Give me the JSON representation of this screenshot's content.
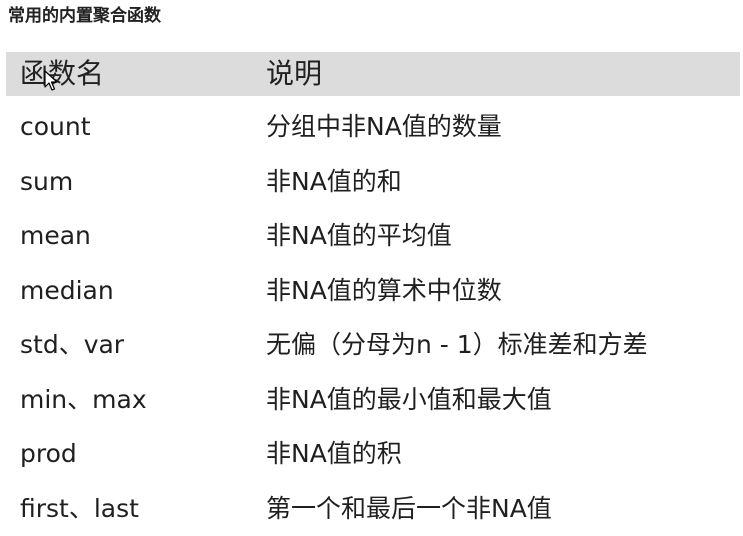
{
  "heading": "常用的内置聚合函数",
  "table": {
    "headers": [
      "函数名",
      "说明"
    ],
    "rows": [
      [
        "count",
        "分组中非NA值的数量"
      ],
      [
        "sum",
        "非NA值的和"
      ],
      [
        "mean",
        "非NA值的平均值"
      ],
      [
        "median",
        "非NA值的算术中位数"
      ],
      [
        "std、var",
        "无偏（分母为n - 1）标准差和方差"
      ],
      [
        "min、max",
        "非NA值的最小值和最大值"
      ],
      [
        "prod",
        "非NA值的积"
      ],
      [
        "first、last",
        "第一个和最后一个非NA值"
      ]
    ]
  },
  "cursor_icon": "arrow-cursor-icon"
}
